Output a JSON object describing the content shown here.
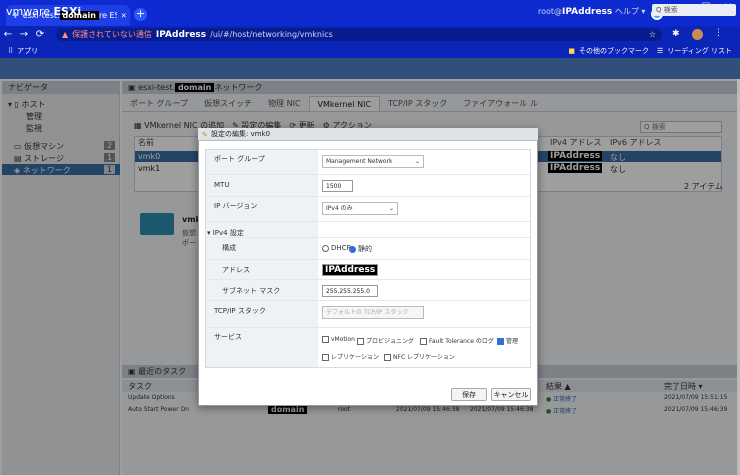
{
  "browser": {
    "tab_title_prefix": "esxi-test.",
    "tab_redacted": "domain",
    "tab_title_suffix": "re ESXi",
    "new_tab": "+",
    "close_tab": "✕",
    "warning": "保護されていない通信",
    "url_redacted": "IPAddress",
    "url_path": "/ui/#/host/networking/vmknics",
    "apps_label": "アプリ",
    "bookmarks_other": "その他のブックマーク",
    "reading_list": "リーディング リスト"
  },
  "vmware": {
    "logo": "vmware",
    "product": "ESXi",
    "user_prefix": "root@",
    "user_ip": "IPAddress",
    "help": "ヘルプ ▾",
    "search_placeholder": "Q 検索"
  },
  "navigator": {
    "title": "ナビゲータ",
    "items": [
      {
        "label": "ホスト"
      },
      {
        "label": "管理"
      },
      {
        "label": "監視"
      },
      {
        "label": "仮想マシン",
        "count": "2"
      },
      {
        "label": "ストレージ",
        "count": "1"
      },
      {
        "label": "ネットワーク",
        "count": "1"
      }
    ]
  },
  "main": {
    "breadcrumb_prefix": "esxi-test.",
    "breadcrumb_redacted": "domain",
    "breadcrumb_suffix": "ネットワーク",
    "tabs": [
      "ポート グループ",
      "仮想スイッチ",
      "物理 NIC",
      "VMkernel NIC",
      "TCP/IP スタック",
      "ファイアウォール ル"
    ],
    "toolbar": [
      "VMkernel NIC の追加",
      "設定の編集",
      "更新",
      "アクション"
    ],
    "search_placeholder": "Q 検索",
    "col_name": "名前",
    "col_ipv4": "IPv4 アドレス",
    "col_ipv6": "IPv6 アドレス",
    "rows": [
      {
        "name": "vmk0",
        "ipv4": "IPAddress",
        "ipv6": "なし"
      },
      {
        "name": "vmk1",
        "ipv4": "IPAddress",
        "ipv6": "なし"
      }
    ],
    "count": "2 アイテム",
    "detail_title": "vmk",
    "detail_line1": "仮想",
    "detail_line2": "ポート"
  },
  "tasks": {
    "title": "最近のタスク",
    "col_task": "タスク",
    "col_result": "結果 ▲",
    "col_completed": "完了日時 ▾",
    "rows": [
      {
        "task": "Update Options",
        "result": "正常終了",
        "completed": "2021/07/09 15:51:15"
      },
      {
        "task": "Auto Start Power On",
        "redacted": "domain",
        "user": "root",
        "queued": "2021/07/09 15:46:38",
        "started": "2021/07/09 15:46:38",
        "result": "正常終了",
        "completed": "2021/07/09 15:46:39"
      }
    ]
  },
  "dialog": {
    "title": "設定の編集: vmk0",
    "port_group_label": "ポート グループ",
    "port_group_value": "Management Network",
    "mtu_label": "MTU",
    "mtu_value": "1500",
    "ip_version_label": "IP バージョン",
    "ip_version_value": "IPv4 のみ",
    "ipv4_section": "▾ IPv4 設定",
    "config_label": "構成",
    "dhcp_label": "DHCP",
    "static_label": "静的",
    "address_label": "アドレス",
    "address_value": "IPAddress",
    "subnet_label": "サブネット マスク",
    "subnet_value": "255.255.255.0",
    "tcpip_label": "TCP/IP スタック",
    "tcpip_value": "デフォルトの TCP/IP スタック",
    "services_label": "サービス",
    "services": {
      "vmotion": "vMotion",
      "provisioning": "プロビジョニング",
      "ft_logging": "Fault Tolerance のログ",
      "management": "管理",
      "replication": "レプリケーション",
      "nfc_replication": "NFC レプリケーション"
    },
    "save": "保存",
    "cancel": "キャンセル"
  }
}
